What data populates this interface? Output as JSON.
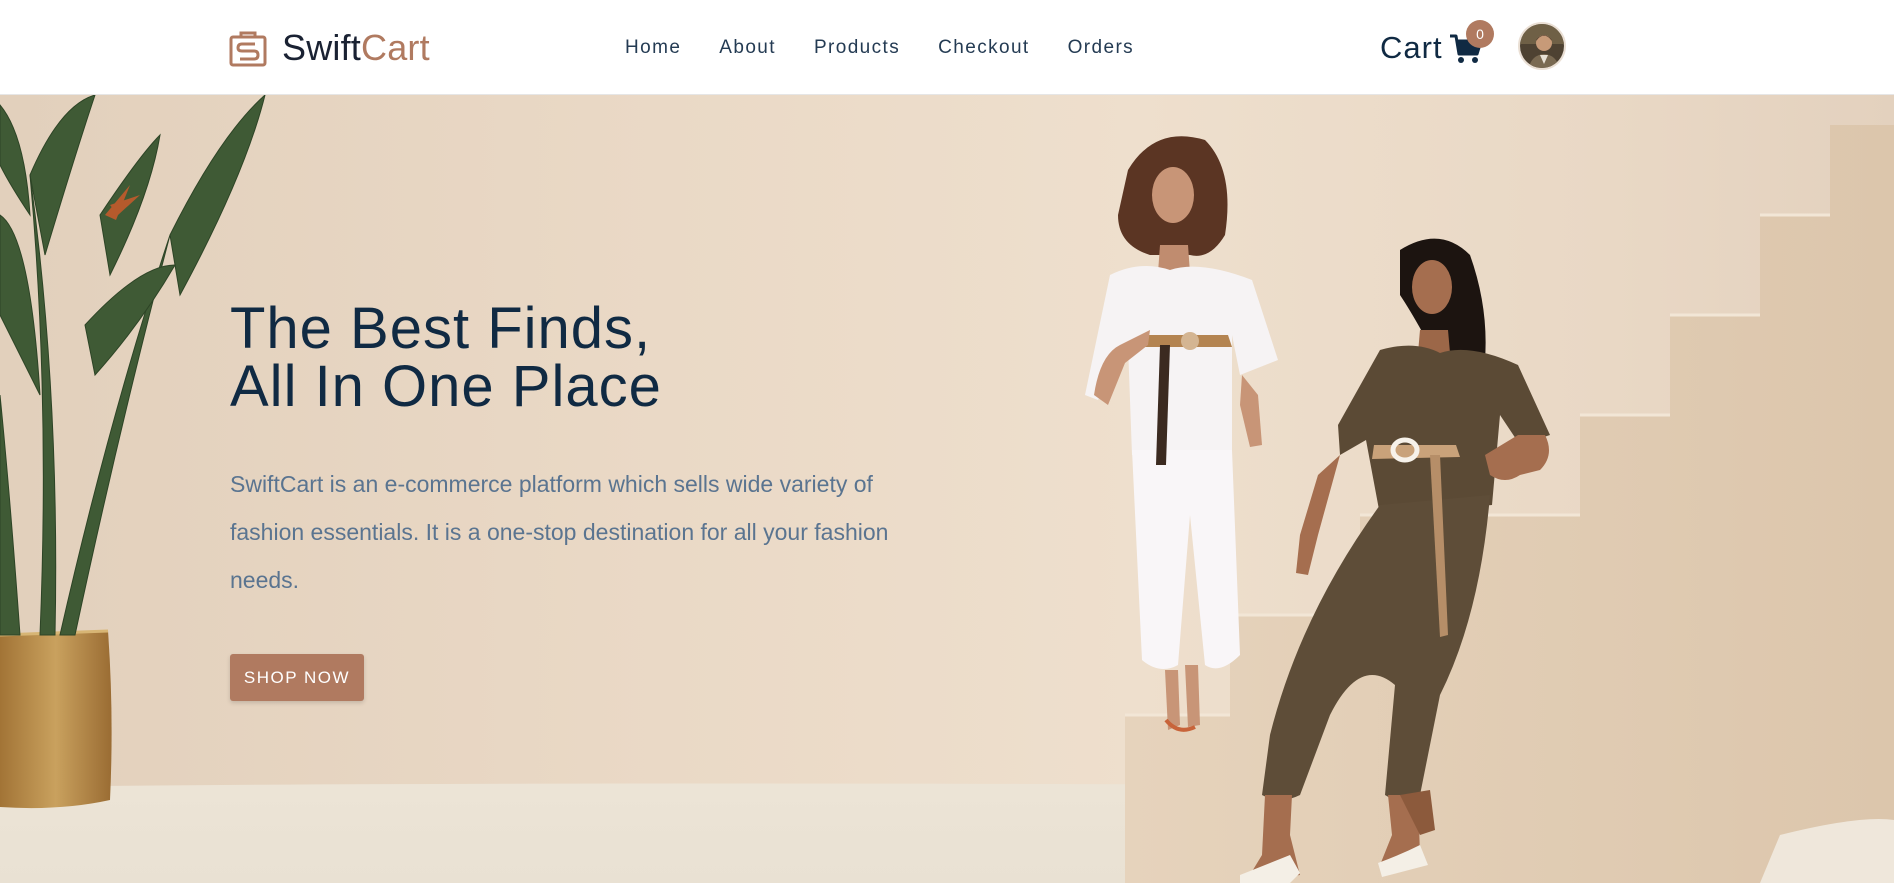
{
  "brand": {
    "name_part1": "Swift",
    "name_part2": "Cart",
    "icon": "shopping-bag-icon"
  },
  "nav": {
    "items": [
      {
        "label": "Home"
      },
      {
        "label": "About"
      },
      {
        "label": "Products"
      },
      {
        "label": "Checkout"
      },
      {
        "label": "Orders"
      }
    ]
  },
  "cart": {
    "label": "Cart",
    "count": "0",
    "icon": "shopping-cart-icon"
  },
  "user": {
    "avatar_icon": "user-avatar"
  },
  "hero": {
    "title_line1": "The Best Finds,",
    "title_line2": "All In One Place",
    "description": "SwiftCart is an e-commerce platform which sells wide variety of fashion essentials. It is a one-stop destination for all your fashion needs.",
    "cta_label": "SHOP NOW"
  },
  "colors": {
    "accent": "#b07a60",
    "navy": "#102a43",
    "text_muted": "#5a7490",
    "hero_bg": "#ead9c6"
  }
}
